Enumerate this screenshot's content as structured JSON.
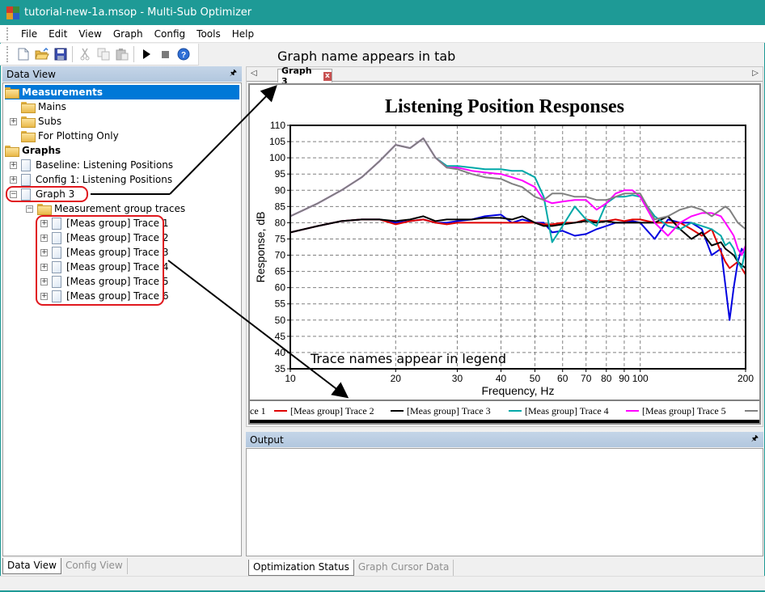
{
  "window": {
    "title": "tutorial-new-1a.msop - Multi-Sub Optimizer",
    "titlebar_color": "#1e9a96"
  },
  "menu": [
    "File",
    "Edit",
    "View",
    "Graph",
    "Config",
    "Tools",
    "Help"
  ],
  "toolbar": {
    "buttons": [
      {
        "name": "new-icon",
        "enabled": true
      },
      {
        "name": "open-icon",
        "enabled": true
      },
      {
        "name": "save-icon",
        "enabled": true
      },
      {
        "name": "cut-icon",
        "enabled": false
      },
      {
        "name": "copy-icon",
        "enabled": false
      },
      {
        "name": "paste-icon",
        "enabled": false
      },
      {
        "name": "run-icon",
        "enabled": true
      },
      {
        "name": "stop-icon",
        "enabled": true
      },
      {
        "name": "help-icon",
        "enabled": true
      }
    ]
  },
  "data_view": {
    "title": "Data View",
    "tree": [
      {
        "label": "Measurements",
        "type": "folder",
        "bold": true,
        "selected": true,
        "expander": ""
      },
      {
        "label": "Mains",
        "type": "folder",
        "expander": ""
      },
      {
        "label": "Subs",
        "type": "folder",
        "expander": "+"
      },
      {
        "label": "For Plotting Only",
        "type": "folder",
        "expander": ""
      },
      {
        "label": "Graphs",
        "type": "folder",
        "bold": true,
        "expander": ""
      },
      {
        "label": "Baseline: Listening Positions",
        "type": "doc",
        "expander": "+"
      },
      {
        "label": "Config 1: Listening Positions",
        "type": "doc",
        "expander": "+"
      },
      {
        "label": "Graph 3",
        "type": "doc",
        "expander": "−"
      },
      {
        "label": "Measurement group traces",
        "type": "folder",
        "expander": "−"
      },
      {
        "label": "[Meas group] Trace 1",
        "type": "doc",
        "expander": "+"
      },
      {
        "label": "[Meas group] Trace 2",
        "type": "doc",
        "expander": "+"
      },
      {
        "label": "[Meas group] Trace 3",
        "type": "doc",
        "expander": "+"
      },
      {
        "label": "[Meas group] Trace 4",
        "type": "doc",
        "expander": "+"
      },
      {
        "label": "[Meas group] Trace 5",
        "type": "doc",
        "expander": "+"
      },
      {
        "label": "[Meas group] Trace 6",
        "type": "doc",
        "expander": "+"
      }
    ],
    "bottom_tabs": [
      {
        "label": "Data View",
        "active": true
      },
      {
        "label": "Config View",
        "active": false
      }
    ]
  },
  "graph_tab": {
    "label": "Graph 3",
    "close_label": "x"
  },
  "output_panel": {
    "title": "Output",
    "bottom_tabs": [
      {
        "label": "Optimization Status",
        "active": true
      },
      {
        "label": "Graph Cursor Data",
        "active": false
      }
    ]
  },
  "annotations": {
    "tab_note": "Graph name appears in tab",
    "legend_note": "Trace names appear in legend"
  },
  "chart_data": {
    "type": "line",
    "title": "Listening Position Responses",
    "xlabel": "Frequency, Hz",
    "ylabel": "Response, dB",
    "xscale": "log",
    "xlim": [
      10,
      200
    ],
    "ylim": [
      35,
      110
    ],
    "xticks": [
      10,
      20,
      30,
      40,
      50,
      60,
      70,
      80,
      90,
      100,
      200
    ],
    "yticks": [
      35,
      40,
      45,
      50,
      55,
      60,
      65,
      70,
      75,
      80,
      85,
      90,
      95,
      100,
      105,
      110
    ],
    "grid": true,
    "legend_position": "bottom",
    "legend_visible_text": [
      "ce 1",
      "[Meas group] Trace 2",
      "[Meas group] Trace 3",
      "[Meas group] Trace 4",
      "[Meas group] Trace 5",
      "["
    ],
    "series": [
      {
        "name": "[Meas group] Trace 1",
        "color": "#0000e0",
        "x": [
          10,
          12,
          14,
          16,
          18,
          20,
          22,
          24,
          26,
          28,
          30,
          33,
          36,
          40,
          43,
          46,
          50,
          53,
          56,
          60,
          65,
          70,
          75,
          80,
          85,
          90,
          95,
          100,
          110,
          120,
          130,
          140,
          150,
          160,
          170,
          175,
          180,
          185,
          190,
          195,
          200
        ],
        "y": [
          77,
          79,
          80.5,
          81,
          81,
          80,
          80.5,
          81,
          80,
          80,
          80.5,
          81,
          82,
          82.5,
          80,
          81,
          80,
          80,
          77,
          77.5,
          76,
          76.5,
          78,
          79,
          80,
          80,
          80.5,
          80,
          75,
          81,
          80,
          80,
          78,
          70,
          72,
          61,
          50,
          60,
          68,
          72,
          70
        ]
      },
      {
        "name": "[Meas group] Trace 2",
        "color": "#e00000",
        "x": [
          10,
          12,
          14,
          16,
          18,
          20,
          22,
          24,
          26,
          28,
          30,
          33,
          36,
          40,
          43,
          46,
          50,
          53,
          56,
          60,
          65,
          70,
          75,
          80,
          85,
          90,
          95,
          100,
          110,
          120,
          130,
          140,
          150,
          160,
          170,
          175,
          180,
          185,
          190,
          195,
          200
        ],
        "y": [
          77,
          79,
          80.5,
          81,
          81,
          79.5,
          80.5,
          81,
          80,
          79.5,
          80,
          80,
          80,
          80,
          80,
          80,
          80,
          79.5,
          79.5,
          80,
          80,
          81,
          80.5,
          80.5,
          81,
          80.5,
          81,
          81,
          80,
          80,
          80,
          78,
          76,
          78,
          71,
          68,
          66,
          67,
          68,
          66,
          64
        ]
      },
      {
        "name": "[Meas group] Trace 3",
        "color": "#000000",
        "x": [
          10,
          12,
          14,
          16,
          18,
          20,
          22,
          24,
          26,
          28,
          30,
          33,
          36,
          40,
          43,
          46,
          50,
          53,
          56,
          60,
          65,
          70,
          75,
          80,
          85,
          90,
          95,
          100,
          110,
          120,
          130,
          140,
          150,
          160,
          170,
          175,
          180,
          185,
          190,
          195,
          200
        ],
        "y": [
          77,
          79,
          80.5,
          81,
          81,
          80.5,
          81,
          82,
          80.5,
          81,
          81,
          81,
          81.5,
          81.5,
          81,
          82,
          80,
          79,
          79,
          79.5,
          80,
          80.5,
          80,
          80.5,
          80,
          80,
          80,
          80,
          80,
          82,
          78,
          75,
          77,
          73,
          74,
          72,
          71,
          70,
          68,
          67,
          66
        ]
      },
      {
        "name": "[Meas group] Trace 4",
        "color": "#00a8a8",
        "x": [
          10,
          12,
          14,
          16,
          18,
          20,
          22,
          24,
          26,
          28,
          30,
          33,
          36,
          40,
          43,
          46,
          50,
          53,
          56,
          60,
          65,
          70,
          75,
          80,
          85,
          90,
          95,
          100,
          110,
          120,
          130,
          140,
          150,
          160,
          170,
          175,
          180,
          185,
          190,
          195,
          200
        ],
        "y": [
          82,
          86,
          90,
          94,
          99,
          104,
          103,
          106,
          100,
          97.5,
          97.5,
          97,
          96.5,
          96.5,
          96,
          96,
          94,
          88,
          74,
          79,
          85,
          81,
          79,
          86,
          88,
          88,
          88.5,
          88,
          82,
          79,
          78,
          80,
          79,
          78,
          76,
          73,
          74,
          72,
          68,
          66,
          72
        ]
      },
      {
        "name": "[Meas group] Trace 5",
        "color": "#ff00ff",
        "x": [
          10,
          12,
          14,
          16,
          18,
          20,
          22,
          24,
          26,
          28,
          30,
          33,
          36,
          40,
          43,
          46,
          50,
          53,
          56,
          60,
          65,
          70,
          75,
          80,
          85,
          90,
          95,
          100,
          110,
          120,
          130,
          140,
          150,
          160,
          170,
          175,
          180,
          185,
          190,
          195,
          200
        ],
        "y": [
          82,
          86,
          90,
          94,
          99,
          104,
          103,
          106,
          100,
          97,
          97,
          96,
          95.5,
          95,
          94,
          93,
          91,
          87,
          86,
          86.5,
          87,
          87,
          84,
          86,
          89,
          90,
          90,
          88,
          80,
          76,
          80,
          82,
          83,
          83,
          82,
          80,
          78,
          76,
          72,
          70,
          73
        ]
      },
      {
        "name": "[Meas group] Trace 6",
        "color": "#808080",
        "x": [
          10,
          12,
          14,
          16,
          18,
          20,
          22,
          24,
          26,
          28,
          30,
          33,
          36,
          40,
          43,
          46,
          50,
          53,
          56,
          60,
          65,
          70,
          75,
          80,
          85,
          90,
          95,
          100,
          110,
          120,
          130,
          140,
          150,
          160,
          170,
          175,
          180,
          185,
          190,
          195,
          200
        ],
        "y": [
          82,
          86,
          90,
          94,
          99,
          104,
          103,
          106,
          100,
          97,
          96.5,
          95,
          94,
          93.5,
          92,
          91,
          88,
          87,
          89,
          89,
          88,
          88,
          87,
          87,
          88,
          89,
          89,
          89,
          81,
          82,
          84,
          85,
          84,
          82,
          84,
          85,
          84,
          82,
          80,
          79,
          78
        ]
      }
    ]
  }
}
